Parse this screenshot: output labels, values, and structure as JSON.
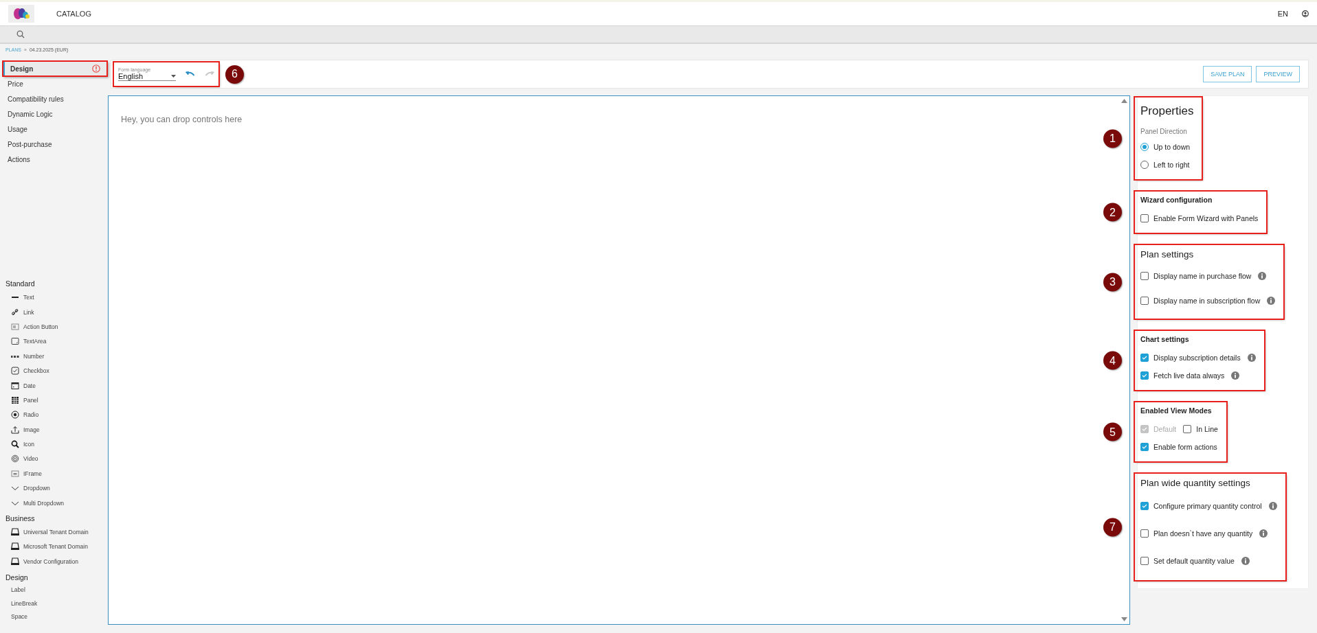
{
  "header": {
    "nav": "CATALOG",
    "language": "EN"
  },
  "breadcrumb": {
    "parent": "PLANS",
    "separator": "»",
    "current": "04.23.2025 (EUR)"
  },
  "nav": [
    {
      "label": "Design",
      "selected": true,
      "warning": true,
      "outlined": true
    },
    {
      "label": "Price",
      "selected": false,
      "warning": false,
      "outlined": false
    },
    {
      "label": "Compatibility rules",
      "selected": false,
      "warning": false,
      "outlined": false
    },
    {
      "label": "Dynamic Logic",
      "selected": false,
      "warning": false,
      "outlined": false
    },
    {
      "label": "Usage",
      "selected": false,
      "warning": false,
      "outlined": false
    },
    {
      "label": "Post-purchase",
      "selected": false,
      "warning": false,
      "outlined": false
    },
    {
      "label": "Actions",
      "selected": false,
      "warning": false,
      "outlined": false
    }
  ],
  "toolbox": [
    {
      "group": "Standard",
      "items": [
        "Text",
        "Link",
        "Action Button",
        "TextArea",
        "Number",
        "Checkbox",
        "Date",
        "Panel",
        "Radio",
        "Image",
        "Icon",
        "Video",
        "IFrame",
        "Dropdown",
        "Multi Dropdown"
      ]
    },
    {
      "group": "Business",
      "items": [
        "Universal Tenant Domain",
        "Microsoft Tenant Domain",
        "Vendor Configuration"
      ]
    },
    {
      "group": "Design",
      "items": [
        "Label",
        "LineBreak",
        "Space"
      ]
    }
  ],
  "toolbar": {
    "annotation": "6",
    "language_label": "Form language",
    "language": "English",
    "undo": {
      "disabled": false
    },
    "redo": {
      "disabled": true
    },
    "buttons": [
      "SAVE PLAN",
      "PREVIEW"
    ]
  },
  "canvas": {
    "hint": "Hey, you can drop controls here"
  },
  "properties": [
    {
      "kind": "radio",
      "large_heading": true,
      "annotation": "1",
      "title": "Properties",
      "subtitle": "Panel Direction",
      "rows": [
        [
          {
            "label": "Up to down",
            "selected": true
          }
        ],
        [
          {
            "label": "Left to right",
            "selected": false
          }
        ]
      ]
    },
    {
      "kind": "checkbox",
      "large_heading": false,
      "annotation": "2",
      "title": "Wizard configuration",
      "rows": [
        [
          {
            "label": "Enable Form Wizard with Panels",
            "checked": false,
            "disabled": false,
            "info": false
          }
        ]
      ]
    },
    {
      "kind": "checkbox",
      "large_heading": true,
      "annotation": "3",
      "title": "Plan settings",
      "rows": [
        [
          {
            "label": "Display name in purchase flow",
            "checked": false,
            "disabled": false,
            "info": true
          }
        ],
        [
          {
            "label": "Display name in subscription flow",
            "checked": false,
            "disabled": false,
            "info": true
          }
        ]
      ]
    },
    {
      "kind": "checkbox",
      "large_heading": false,
      "annotation": "4",
      "title": "Chart settings",
      "rows": [
        [
          {
            "label": "Display subscription details",
            "checked": true,
            "disabled": false,
            "info": true
          }
        ],
        [
          {
            "label": "Fetch live data always",
            "checked": true,
            "disabled": false,
            "info": true
          }
        ]
      ]
    },
    {
      "kind": "checkbox",
      "large_heading": false,
      "annotation": "5",
      "title": "Enabled View Modes",
      "rows": [
        [
          {
            "label": "Default",
            "checked": true,
            "disabled": true,
            "info": false
          },
          {
            "label": "In Line",
            "checked": false,
            "disabled": false,
            "info": false
          }
        ],
        [
          {
            "label": "Enable form actions",
            "checked": true,
            "disabled": false,
            "info": false
          }
        ]
      ]
    },
    {
      "kind": "checkbox",
      "large_heading": true,
      "annotation": "7",
      "title": "Plan wide quantity settings",
      "rows": [
        [
          {
            "label": "Configure primary quantity control",
            "checked": true,
            "disabled": false,
            "info": true
          }
        ],
        [
          {
            "label": "Plan doesn`t have any quantity",
            "checked": false,
            "disabled": false,
            "info": true
          }
        ],
        [
          {
            "label": "Set default quantity value",
            "checked": false,
            "disabled": false,
            "info": true
          }
        ]
      ]
    }
  ]
}
